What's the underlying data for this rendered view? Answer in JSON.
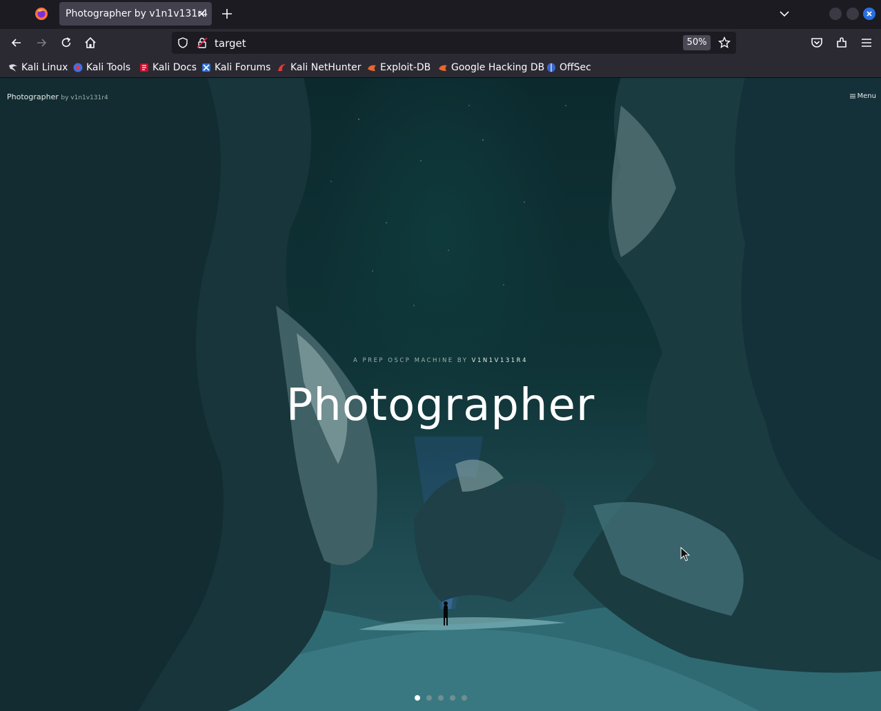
{
  "browser": {
    "tab_title": "Photographer by v1n1v131r4",
    "url": "target",
    "zoom": "50%"
  },
  "bookmarks": [
    {
      "label": "Kali Linux",
      "icon": "kali-dragon-icon"
    },
    {
      "label": "Kali Tools",
      "icon": "kali-tools-icon"
    },
    {
      "label": "Kali Docs",
      "icon": "kali-docs-icon"
    },
    {
      "label": "Kali Forums",
      "icon": "kali-forums-icon"
    },
    {
      "label": "Kali NetHunter",
      "icon": "kali-nethunter-icon"
    },
    {
      "label": "Exploit-DB",
      "icon": "exploit-db-icon"
    },
    {
      "label": "Google Hacking DB",
      "icon": "ghdb-icon"
    },
    {
      "label": "OffSec",
      "icon": "offsec-icon"
    }
  ],
  "site": {
    "brand": "Photographer",
    "brand_sub": "by v1n1v131r4",
    "menu_label": "Menu",
    "kicker_prefix": "A PREP OSCP MACHINE BY ",
    "kicker_author": "V1N1V131R4",
    "hero_title": "Photographer",
    "slides": 5,
    "active_slide": 1
  },
  "colors": {
    "accent": "#2a6fe0",
    "toolbar": "#2b2a33",
    "tabbar": "#1c1b22"
  }
}
